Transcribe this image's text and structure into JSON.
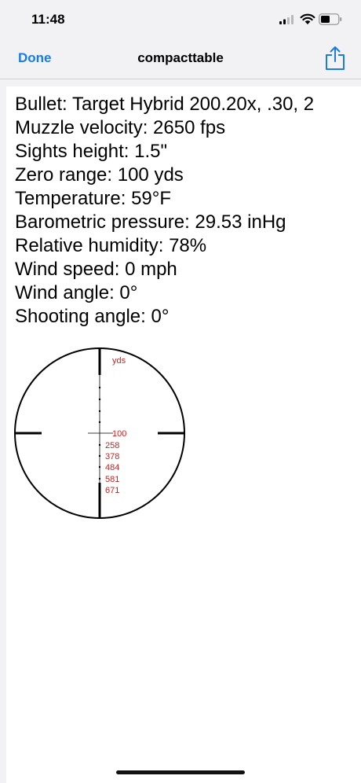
{
  "status_bar": {
    "time": "11:48",
    "icons": [
      "signal-icon",
      "wifi-icon",
      "battery-icon"
    ]
  },
  "nav": {
    "done_label": "Done",
    "title": "compacttable",
    "share_icon": "share-icon",
    "accent_color": "#1a7ae6"
  },
  "info_lines": [
    "Bullet: Target Hybrid 200.20x, .30, 2",
    "Muzzle velocity: 2650 fps",
    "Sights height: 1.5\"",
    "Zero range: 100 yds",
    "Temperature: 59°F",
    "Barometric pressure: 29.53 inHg",
    "Relative humidity: 78%",
    "Wind speed: 0 mph",
    "Wind angle: 0°",
    "Shooting angle: 0°"
  ],
  "reticle": {
    "unit_label": "yds",
    "zero_label": "100",
    "range_labels": [
      "258",
      "378",
      "484",
      "581",
      "671"
    ],
    "label_color": "#d02020"
  }
}
